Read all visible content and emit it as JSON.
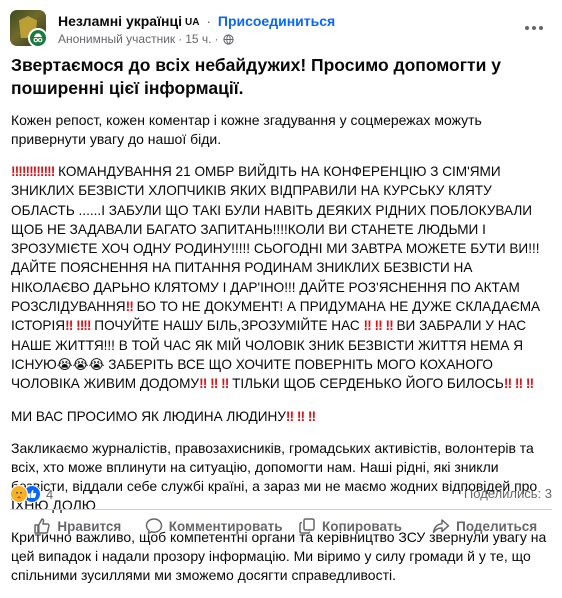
{
  "post": {
    "group_name": "Незламні українці",
    "group_flag": "UA",
    "separator": "·",
    "join_label": "Присоединиться",
    "author": "Анонимный участник",
    "time": "15 ч.",
    "headline": "Звертаємося до всіх небайдужих! Просимо допомогти у поширенні цієї інформації.",
    "p1": "Кожен репост, кожен коментар і кожне згадування у соцмережах можуть привернути увагу до нашої біди.",
    "p2": {
      "a": "КОМАНДУВАННЯ 21 ОМБР ВИЙДІТЬ НА КОНФЕРЕНЦІЮ З СІМ'ЯМИ ЗНИКЛИХ БЕЗВІСТИ ХЛОПЧИКІВ ЯКИХ ВІДПРАВИЛИ НА КУРСЬКУ КЛЯТУ ОБЛАСТЬ ......І ЗАБУЛИ ЩО ТАКІ БУЛИ НАВІТЬ ДЕЯКИХ РІДНИХ ПОБЛОКУВАЛИ ЩОБ НЕ ЗАДАВАЛИ БАГАТО ЗАПИТАНЬ!!!!КОЛИ ВИ СТАНЕТЕ ЛЮДЬМИ І ЗРОЗУМІЄТЕ ХОЧ ОДНУ РОДИНУ!!!!! СЬОГОДНІ МИ ЗАВТРА МОЖЕТЕ БУТИ ВИ!!! ДАЙТЕ ПОЯСНЕННЯ НА ПИТАННЯ РОДИНАМ ЗНИКЛИХ БЕЗВІСТИ НА НІКОЛАЄВО ДАРЬНО КЛЯТОМУ І ДАР'ІНО!!! ДАЙТЕ РОЗ'ЯСНЕННЯ ПО АКТАМ РОЗСЛІДУВАННЯ",
      "b": "БО ТО НЕ ДОКУМЕНТ! А ПРИДУМАНА НЕ ДУЖЕ СКЛАДАЄМА ІСТОРІЯ",
      "c": "ПОЧУЙТЕ НАШУ БІЛЬ,ЗРОЗУМІЙТЕ НАС",
      "d": "ВИ ЗАБРАЛИ У НАС НАШЕ ЖИТТЯ!!! В ТОЙ ЧАС ЯК МІЙ ЧОЛОВІК ЗНИК БЕЗВІСТИ ЖИТТЯ НЕМА Я ІСНУЮ",
      "e": "ЗАБЕРІТЬ ВСЕ ЩО ХОЧИТЕ ПОВЕРНІТЬ МОГО КОХАНОГО ЧОЛОВІКА ЖИВИМ ДОДОМУ",
      "f": "ТІЛЬКИ ЩОБ СЕРДЕНЬКО ЙОГО БИЛОСЬ"
    },
    "p3": "МИ ВАС ПРОСИМО ЯК ЛЮДИНА ЛЮДИНУ",
    "p4": "Закликаємо журналістів, правозахисників, громадських активістів, волонтерів та всіх, хто може вплинути на ситуацію, допомогти нам. Наші рідні, які зникли безвісти, віддали себе службі країні, а зараз ми не маємо жодних відповідей про ЇХНЮ ДОЛЮ",
    "p5": "Критично важливо, щоб компетентні органи та керівництво ЗСУ звернули увагу на цей випадок і надали прозору інформацію. Ми віримо у силу громади й у те, що спільними зусиллями ми зможемо досягти справедливості.",
    "bang": "‼",
    "cry": "😭",
    "reaction_count": "4",
    "shares": "Поделились: 3",
    "actions": {
      "like": "Нравится",
      "comment": "Комментировать",
      "copy": "Копировать",
      "share": "Поделиться"
    }
  },
  "icons": {
    "avatar": "group-avatar",
    "anonymous": "anonymous-badge-icon",
    "globe": "globe-icon",
    "more": "more-options-icon",
    "care": "care-reaction-icon",
    "like": "like-reaction-icon"
  },
  "colors": {
    "link": "#0866ff",
    "text": "#080809",
    "secondary": "#65676b",
    "bang": "#d8141b",
    "anon_badge": "#1b7a3e"
  }
}
